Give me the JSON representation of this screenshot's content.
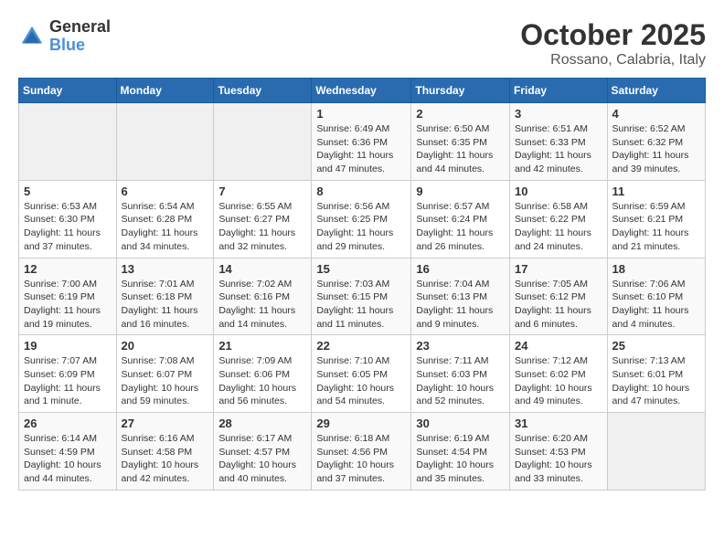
{
  "header": {
    "logo_general": "General",
    "logo_blue": "Blue",
    "month_title": "October 2025",
    "location": "Rossano, Calabria, Italy"
  },
  "weekdays": [
    "Sunday",
    "Monday",
    "Tuesday",
    "Wednesday",
    "Thursday",
    "Friday",
    "Saturday"
  ],
  "weeks": [
    [
      {
        "day": "",
        "info": ""
      },
      {
        "day": "",
        "info": ""
      },
      {
        "day": "",
        "info": ""
      },
      {
        "day": "1",
        "info": "Sunrise: 6:49 AM\nSunset: 6:36 PM\nDaylight: 11 hours and 47 minutes."
      },
      {
        "day": "2",
        "info": "Sunrise: 6:50 AM\nSunset: 6:35 PM\nDaylight: 11 hours and 44 minutes."
      },
      {
        "day": "3",
        "info": "Sunrise: 6:51 AM\nSunset: 6:33 PM\nDaylight: 11 hours and 42 minutes."
      },
      {
        "day": "4",
        "info": "Sunrise: 6:52 AM\nSunset: 6:32 PM\nDaylight: 11 hours and 39 minutes."
      }
    ],
    [
      {
        "day": "5",
        "info": "Sunrise: 6:53 AM\nSunset: 6:30 PM\nDaylight: 11 hours and 37 minutes."
      },
      {
        "day": "6",
        "info": "Sunrise: 6:54 AM\nSunset: 6:28 PM\nDaylight: 11 hours and 34 minutes."
      },
      {
        "day": "7",
        "info": "Sunrise: 6:55 AM\nSunset: 6:27 PM\nDaylight: 11 hours and 32 minutes."
      },
      {
        "day": "8",
        "info": "Sunrise: 6:56 AM\nSunset: 6:25 PM\nDaylight: 11 hours and 29 minutes."
      },
      {
        "day": "9",
        "info": "Sunrise: 6:57 AM\nSunset: 6:24 PM\nDaylight: 11 hours and 26 minutes."
      },
      {
        "day": "10",
        "info": "Sunrise: 6:58 AM\nSunset: 6:22 PM\nDaylight: 11 hours and 24 minutes."
      },
      {
        "day": "11",
        "info": "Sunrise: 6:59 AM\nSunset: 6:21 PM\nDaylight: 11 hours and 21 minutes."
      }
    ],
    [
      {
        "day": "12",
        "info": "Sunrise: 7:00 AM\nSunset: 6:19 PM\nDaylight: 11 hours and 19 minutes."
      },
      {
        "day": "13",
        "info": "Sunrise: 7:01 AM\nSunset: 6:18 PM\nDaylight: 11 hours and 16 minutes."
      },
      {
        "day": "14",
        "info": "Sunrise: 7:02 AM\nSunset: 6:16 PM\nDaylight: 11 hours and 14 minutes."
      },
      {
        "day": "15",
        "info": "Sunrise: 7:03 AM\nSunset: 6:15 PM\nDaylight: 11 hours and 11 minutes."
      },
      {
        "day": "16",
        "info": "Sunrise: 7:04 AM\nSunset: 6:13 PM\nDaylight: 11 hours and 9 minutes."
      },
      {
        "day": "17",
        "info": "Sunrise: 7:05 AM\nSunset: 6:12 PM\nDaylight: 11 hours and 6 minutes."
      },
      {
        "day": "18",
        "info": "Sunrise: 7:06 AM\nSunset: 6:10 PM\nDaylight: 11 hours and 4 minutes."
      }
    ],
    [
      {
        "day": "19",
        "info": "Sunrise: 7:07 AM\nSunset: 6:09 PM\nDaylight: 11 hours and 1 minute."
      },
      {
        "day": "20",
        "info": "Sunrise: 7:08 AM\nSunset: 6:07 PM\nDaylight: 10 hours and 59 minutes."
      },
      {
        "day": "21",
        "info": "Sunrise: 7:09 AM\nSunset: 6:06 PM\nDaylight: 10 hours and 56 minutes."
      },
      {
        "day": "22",
        "info": "Sunrise: 7:10 AM\nSunset: 6:05 PM\nDaylight: 10 hours and 54 minutes."
      },
      {
        "day": "23",
        "info": "Sunrise: 7:11 AM\nSunset: 6:03 PM\nDaylight: 10 hours and 52 minutes."
      },
      {
        "day": "24",
        "info": "Sunrise: 7:12 AM\nSunset: 6:02 PM\nDaylight: 10 hours and 49 minutes."
      },
      {
        "day": "25",
        "info": "Sunrise: 7:13 AM\nSunset: 6:01 PM\nDaylight: 10 hours and 47 minutes."
      }
    ],
    [
      {
        "day": "26",
        "info": "Sunrise: 6:14 AM\nSunset: 4:59 PM\nDaylight: 10 hours and 44 minutes."
      },
      {
        "day": "27",
        "info": "Sunrise: 6:16 AM\nSunset: 4:58 PM\nDaylight: 10 hours and 42 minutes."
      },
      {
        "day": "28",
        "info": "Sunrise: 6:17 AM\nSunset: 4:57 PM\nDaylight: 10 hours and 40 minutes."
      },
      {
        "day": "29",
        "info": "Sunrise: 6:18 AM\nSunset: 4:56 PM\nDaylight: 10 hours and 37 minutes."
      },
      {
        "day": "30",
        "info": "Sunrise: 6:19 AM\nSunset: 4:54 PM\nDaylight: 10 hours and 35 minutes."
      },
      {
        "day": "31",
        "info": "Sunrise: 6:20 AM\nSunset: 4:53 PM\nDaylight: 10 hours and 33 minutes."
      },
      {
        "day": "",
        "info": ""
      }
    ]
  ]
}
